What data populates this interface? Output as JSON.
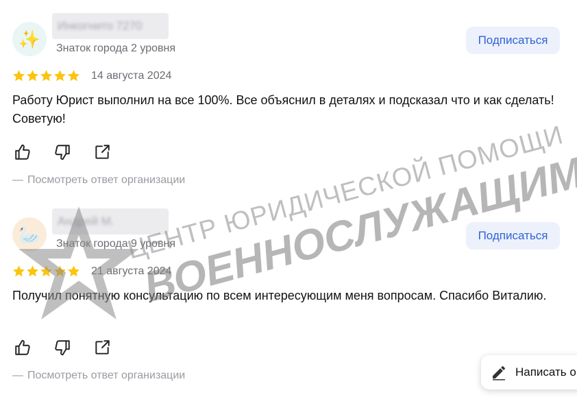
{
  "reviews": [
    {
      "avatar_emoji": "✨",
      "avatar_bg": "#e9f6f5",
      "author": "Инкогнито 7270",
      "level": "Знаток города 2 уровня",
      "subscribe_label": "Подписаться",
      "rating": 5,
      "date": "14 августа 2024",
      "text": "Работу Юрист выполнил на все 100%. Все объяснил в деталях и подсказал что и как сделать! Советую!",
      "icons": [
        "thumb-up-icon",
        "thumb-down-icon",
        "share-icon"
      ],
      "org_link": "Посмотреть ответ организации"
    },
    {
      "avatar_emoji": "🦢",
      "avatar_bg": "#fbecd9",
      "author": "Андрей М.",
      "level": "Знаток города 9 уровня",
      "subscribe_label": "Подписаться",
      "rating": 5,
      "date": "21 августа 2024",
      "text": "Получил понятную консультацию по всем интересующим меня вопросам. Спасибо Виталию.",
      "icons": [
        "thumb-up-icon",
        "thumb-down-icon",
        "share-icon"
      ],
      "org_link": "Посмотреть ответ организации"
    }
  ],
  "write_review": {
    "label": "Написать о",
    "icon": "pencil-icon"
  },
  "watermark": {
    "line1": "ЦЕНТР ЮРИДИЧЕСКОЙ ПОМОЩИ",
    "line2": "ВОЕННОСЛУЖАЩИМ",
    "icon": "star-icon"
  },
  "colors": {
    "star": "#fcc40c",
    "accent": "#2f62d8",
    "subscribe_bg": "#edf1fb",
    "muted": "#6b6b73",
    "watermark": "#8a8a8a"
  }
}
